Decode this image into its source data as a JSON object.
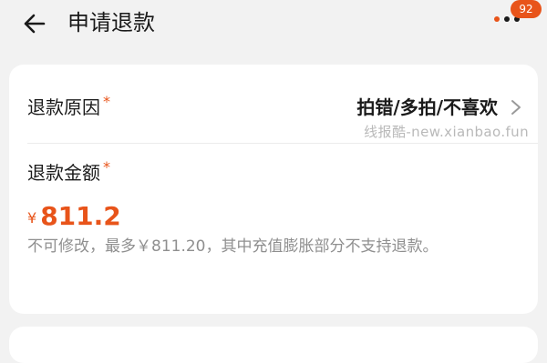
{
  "header": {
    "title": "申请退款",
    "back_icon": "back-arrow-icon",
    "more_icon": "more-dots-icon",
    "notification_count": "92",
    "accent_color": "#e8541a"
  },
  "refund": {
    "reason_label": "退款原因",
    "required_mark": "*",
    "reason_value": "拍错/多拍/不喜欢",
    "watermark": "线报酷-new.xianbao.fun",
    "amount_label": "退款金额",
    "currency_symbol": "¥",
    "amount": "811.2",
    "note": "不可修改，最多￥811.20，其中充值膨胀部分不支持退款。"
  }
}
